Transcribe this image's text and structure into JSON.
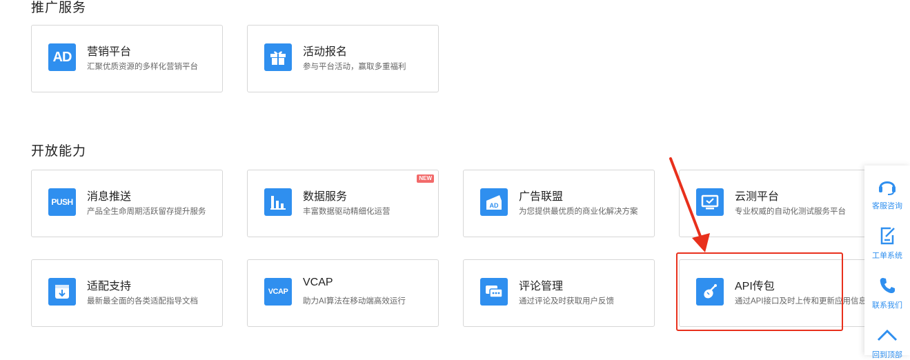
{
  "sections": [
    {
      "title": "推广服务"
    },
    {
      "title": "开放能力"
    }
  ],
  "cards": {
    "marketing": {
      "title": "营销平台",
      "desc": "汇聚优质资源的多样化营销平台",
      "icon": "ad-icon",
      "icon_text": "AD"
    },
    "events": {
      "title": "活动报名",
      "desc": "参与平台活动，赢取多重福利",
      "icon": "gift-icon"
    },
    "push": {
      "title": "消息推送",
      "desc": "产品全生命周期活跃留存提升服务",
      "icon": "push-icon",
      "icon_text": "PUSH"
    },
    "data": {
      "title": "数据服务",
      "desc": "丰富数据驱动精细化运营",
      "icon": "bar-chart-icon",
      "badge": "NEW"
    },
    "ads": {
      "title": "广告联盟",
      "desc": "为您提供最优质的商业化解决方案",
      "icon": "ad-union-icon",
      "icon_text": "AD"
    },
    "cloudtest": {
      "title": "云测平台",
      "desc": "专业权威的自动化测试服务平台",
      "icon": "monitor-icon"
    },
    "adapt": {
      "title": "适配支持",
      "desc": "最新最全面的各类适配指导文档",
      "icon": "download-box-icon"
    },
    "vcap": {
      "title": "VCAP",
      "desc": "助力AI算法在移动端高效运行",
      "icon": "vcap-icon",
      "icon_text": "VCAP"
    },
    "comments": {
      "title": "评论管理",
      "desc": "通过评论及时获取用户反馈",
      "icon": "comment-icon"
    },
    "api": {
      "title": "API传包",
      "desc": "通过API接口及时上传和更新应用信息",
      "icon": "upload-api-icon"
    }
  },
  "float_bar": {
    "items": [
      {
        "label": "客服咨询",
        "icon": "headset-icon"
      },
      {
        "label": "工单系统",
        "icon": "edit-document-icon"
      },
      {
        "label": "联系我们",
        "icon": "phone-icon"
      },
      {
        "label": "回到顶部",
        "icon": "chevron-up-icon"
      }
    ]
  },
  "colors": {
    "accent": "#2f8fef",
    "annotation": "#e8301c",
    "badge": "#f26a6a",
    "border": "#d6d6d6"
  }
}
